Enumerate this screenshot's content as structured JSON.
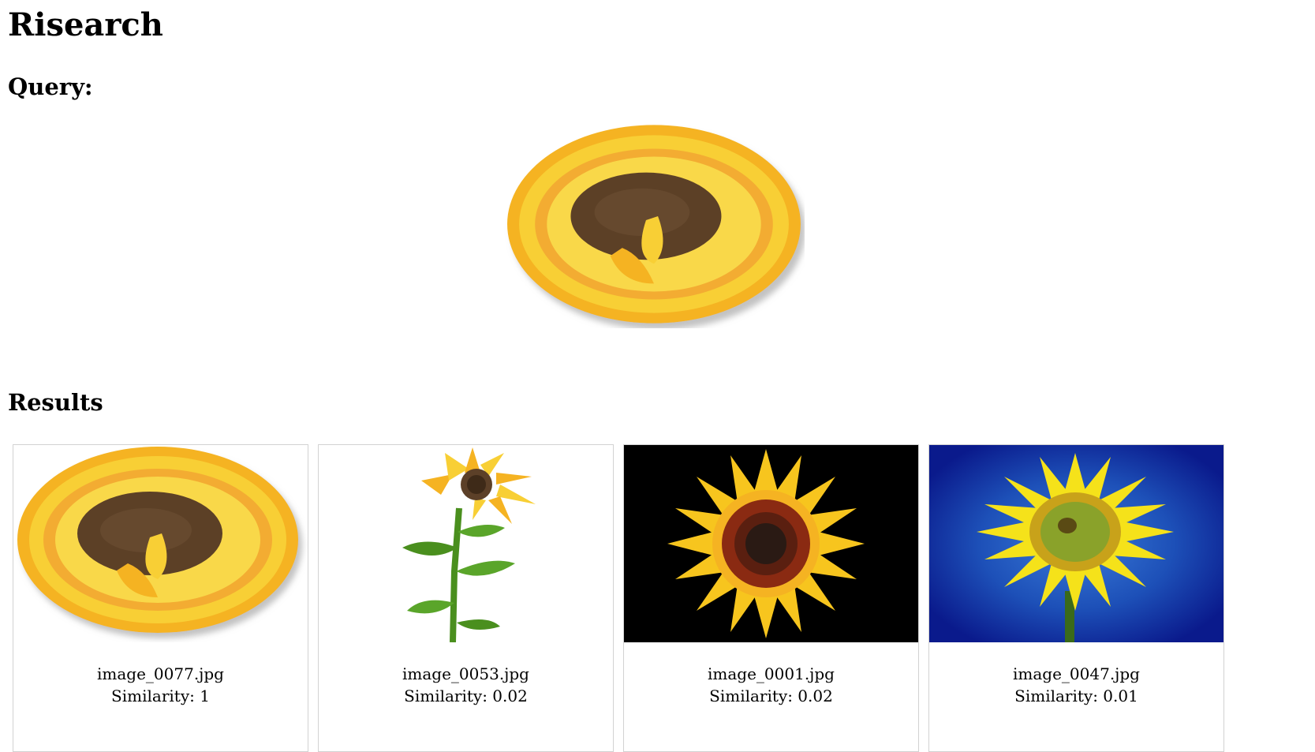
{
  "page": {
    "title": "Risearch",
    "query_heading": "Query:",
    "results_heading": "Results"
  },
  "query": {
    "image_icon": "sunflower-head-drawing"
  },
  "results": [
    {
      "filename": "image_0077.jpg",
      "similarity": "Similarity: 1",
      "image_icon": "sunflower-head-drawing"
    },
    {
      "filename": "image_0053.jpg",
      "similarity": "Similarity: 0.02",
      "image_icon": "sunflower-stem"
    },
    {
      "filename": "image_0001.jpg",
      "similarity": "Similarity: 0.02",
      "image_icon": "sunflower-black-background"
    },
    {
      "filename": "image_0047.jpg",
      "similarity": "Similarity: 0.01",
      "image_icon": "sunflower-blue-background"
    }
  ],
  "colors": {
    "petal_yellow": "#f7c51e",
    "petal_red": "#e3582a",
    "seed_brown": "#5c4028",
    "leaf_green": "#4a8f1e",
    "black_bg": "#000000",
    "blue_bg": "#0a1a8c",
    "card_border": "#d2d2d2"
  }
}
